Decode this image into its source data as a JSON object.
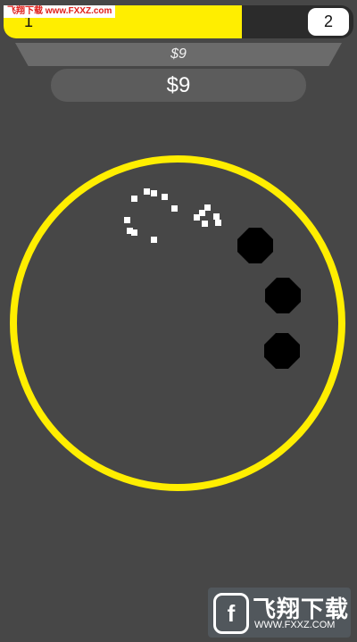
{
  "level": {
    "current": "1",
    "next": "2",
    "progress": 0.68
  },
  "watermark_top": "飞翔下载 www.FXXZ.com",
  "earnings": {
    "per_hit": "$9",
    "total": "$9"
  },
  "colors": {
    "ring": "#ffee00",
    "fill": "#ffee00",
    "obstacle": "#000000",
    "particle": "#ffffff",
    "background": "#474747"
  },
  "logo": {
    "name": "飞翔下载",
    "url": "WWW.FXXZ.COM",
    "icon": "f-logo-icon"
  }
}
